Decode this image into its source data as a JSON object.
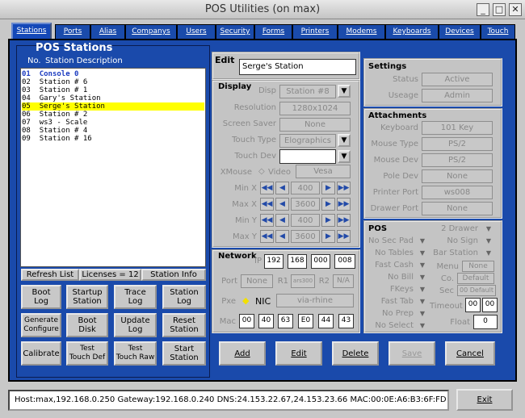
{
  "window": {
    "title": "POS Utilities (on max)",
    "min": "_",
    "max": "□",
    "close": "✕"
  },
  "tabs": [
    "Stations",
    "Ports",
    "Alias",
    "Companys",
    "Users",
    "Security",
    "Forms",
    "Printers",
    "Modems",
    "Keyboards",
    "Devices",
    "Touch"
  ],
  "stations": {
    "heading": "POS Stations",
    "col_no": "No.",
    "col_desc": "Station Description",
    "rows": [
      {
        "no": "01",
        "desc": "Console 0"
      },
      {
        "no": "02",
        "desc": "Station # 6"
      },
      {
        "no": "03",
        "desc": "Station # 1"
      },
      {
        "no": "04",
        "desc": "Gary's Station"
      },
      {
        "no": "05",
        "desc": "Serge's Station"
      },
      {
        "no": "06",
        "desc": "Station # 2"
      },
      {
        "no": "07",
        "desc": "ws3 - Scale"
      },
      {
        "no": "08",
        "desc": "Station # 4"
      },
      {
        "no": "09",
        "desc": "Station # 16"
      }
    ],
    "refresh": "Refresh List",
    "licenses": "Licenses = 12",
    "info": "Station Info"
  },
  "actions": [
    [
      "Boot",
      "Log"
    ],
    [
      "Startup",
      "Station"
    ],
    [
      "Trace",
      "Log"
    ],
    [
      "Station",
      "Log"
    ],
    [
      "Generate",
      "Configure"
    ],
    [
      "Boot",
      "Disk"
    ],
    [
      "Update",
      "Log"
    ],
    [
      "Reset",
      "Station"
    ],
    [
      "Calibrate",
      ""
    ],
    [
      "Test",
      "Touch Def"
    ],
    [
      "Test",
      "Touch Raw"
    ],
    [
      "Start",
      "Station"
    ]
  ],
  "edit": {
    "label": "Edit",
    "value": "Serge's Station"
  },
  "display": {
    "title": "Display",
    "disp_label": "Disp",
    "disp": "Station #8",
    "res_label": "Resolution",
    "res": "1280x1024",
    "saver_label": "Screen Saver",
    "saver": "None",
    "touch_type_label": "Touch Type",
    "touch_type": "Elographics",
    "touch_dev_label": "Touch Dev",
    "touch_dev": "",
    "xmouse_label": "XMouse",
    "video_label": "Video",
    "xmouse": "Vesa",
    "minx_label": "Min X",
    "minx": "400",
    "maxx_label": "Max X",
    "maxx": "3600",
    "miny_label": "Min Y",
    "miny": "400",
    "maxy_label": "Max Y",
    "maxy": "3600"
  },
  "network": {
    "title": "Network",
    "ip_label": "IP",
    "ip": [
      "192",
      "168",
      "000",
      "008"
    ],
    "port_label": "Port",
    "port": "None",
    "r1_label": "R1",
    "r1": "ars300",
    "r2_label": "R2",
    "r2": "N/A",
    "pxe_label": "Pxe",
    "nic_label": "NIC",
    "nic": "via-rhine",
    "mac_label": "Mac",
    "mac": [
      "00",
      "40",
      "63",
      "E0",
      "44",
      "43"
    ]
  },
  "settings": {
    "title": "Settings",
    "status_label": "Status",
    "status": "Active",
    "usage_label": "Useage",
    "usage": "Admin"
  },
  "attachments": {
    "title": "Attachments",
    "keyboard_label": "Keyboard",
    "keyboard": "101 Key",
    "mouse_type_label": "Mouse Type",
    "mouse_type": "PS/2",
    "mouse_dev_label": "Mouse Dev",
    "mouse_dev": "PS/2",
    "pole_label": "Pole Dev",
    "pole": "None",
    "printer_label": "Printer Port",
    "printer": "ws008",
    "drawer_label": "Drawer Port",
    "drawer": "None"
  },
  "pos": {
    "title": "POS",
    "left": [
      "No Sec Pad",
      "No Tables",
      "Fast Cash",
      "No Bill",
      "FKeys",
      "Fast Tab",
      "No Prep",
      "No Select"
    ],
    "right": [
      "2 Drawer",
      "No Sign",
      "Bar Station"
    ],
    "menu_label": "Menu",
    "menu": "None",
    "co_label": "Co.",
    "co": "Default",
    "sec_label": "Sec",
    "sec": "00 Default",
    "timeout_label": "Timeout",
    "timeout": [
      "00",
      "00"
    ],
    "float_label": "Float",
    "float": "0"
  },
  "buttons": {
    "add": "Add",
    "edit": "Edit",
    "delete": "Delete",
    "save": "Save",
    "cancel": "Cancel",
    "exit": "Exit"
  },
  "status": "Host:max,192.168.0.250 Gateway:192.168.0.240 DNS:24.153.22.67,24.153.23.66 MAC:00:0E:A6:B3:6F:FD"
}
